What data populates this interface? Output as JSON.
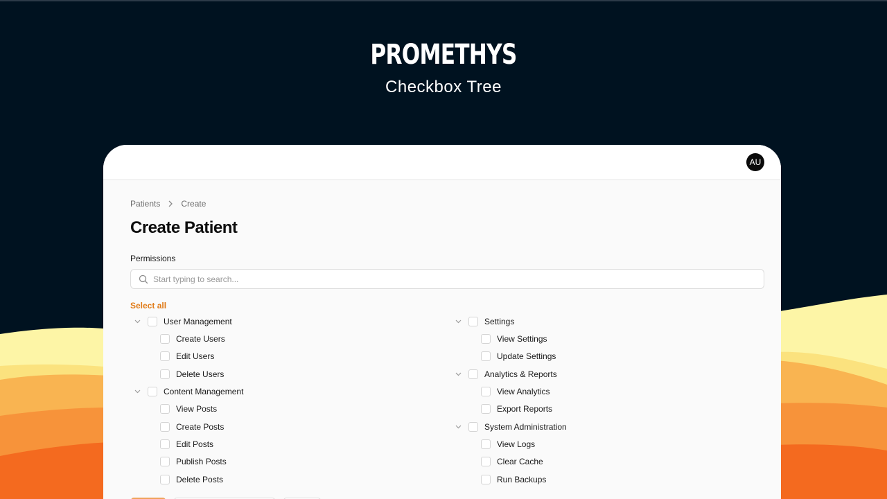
{
  "hero": {
    "title": "PROMETHYS",
    "subtitle": "Checkbox Tree"
  },
  "header": {
    "avatar_initials": "AU"
  },
  "breadcrumb": [
    "Patients",
    "Create"
  ],
  "page": {
    "title": "Create Patient",
    "section_label": "Permissions"
  },
  "search": {
    "placeholder": "Start typing to search...",
    "value": ""
  },
  "select_all_label": "Select all",
  "tree": {
    "left": [
      {
        "label": "User Management",
        "children": [
          "Create Users",
          "Edit Users",
          "Delete Users"
        ]
      },
      {
        "label": "Content Management",
        "children": [
          "View Posts",
          "Create Posts",
          "Edit Posts",
          "Publish Posts",
          "Delete Posts"
        ]
      }
    ],
    "right": [
      {
        "label": "Settings",
        "children": [
          "View Settings",
          "Update Settings"
        ]
      },
      {
        "label": "Analytics & Reports",
        "children": [
          "View Analytics",
          "Export Reports"
        ]
      },
      {
        "label": "System Administration",
        "children": [
          "View Logs",
          "Clear Cache",
          "Run Backups"
        ]
      }
    ]
  },
  "colors": {
    "background": "#001220",
    "accent": "#e07b18",
    "wave_1": "#fdf5a6",
    "wave_2": "#fbe27e",
    "wave_3": "#f9b451",
    "wave_4": "#f7933a",
    "wave_5": "#f46a1f"
  }
}
